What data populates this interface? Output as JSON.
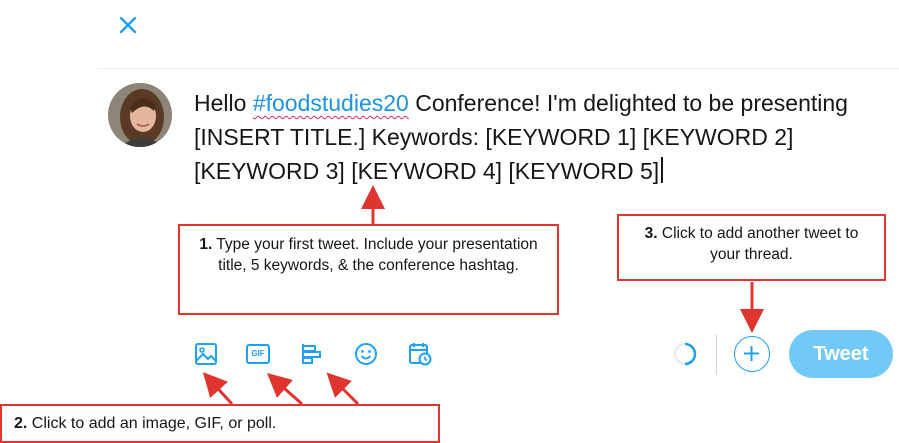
{
  "tweet": {
    "before_hashtag": "Hello ",
    "hashtag": "#foodstudies20",
    "after_hashtag": " Conference! I'm delighted to be presenting [INSERT TITLE.] Keywords: [KEYWORD 1] [KEYWORD 2] [KEYWORD 3] [KEYWORD 4] [KEYWORD 5]"
  },
  "callouts": {
    "step1": {
      "number": "1.",
      "text": " Type your first tweet. Include your presentation title, 5 keywords, & the conference hashtag."
    },
    "step2": {
      "number": "2.",
      "text": " Click to add an image, GIF, or poll."
    },
    "step3": {
      "number": "3.",
      "text": " Click to add another tweet to your thread."
    }
  },
  "toolbar": {
    "icons": [
      "image-icon",
      "gif-icon",
      "poll-icon",
      "emoji-icon",
      "schedule-icon"
    ],
    "gif_label": "GIF",
    "tweet_label": "Tweet",
    "accent_color": "#1da1f2",
    "tweet_button_color": "#71c9f8",
    "callout_border_color": "#e0342e"
  }
}
